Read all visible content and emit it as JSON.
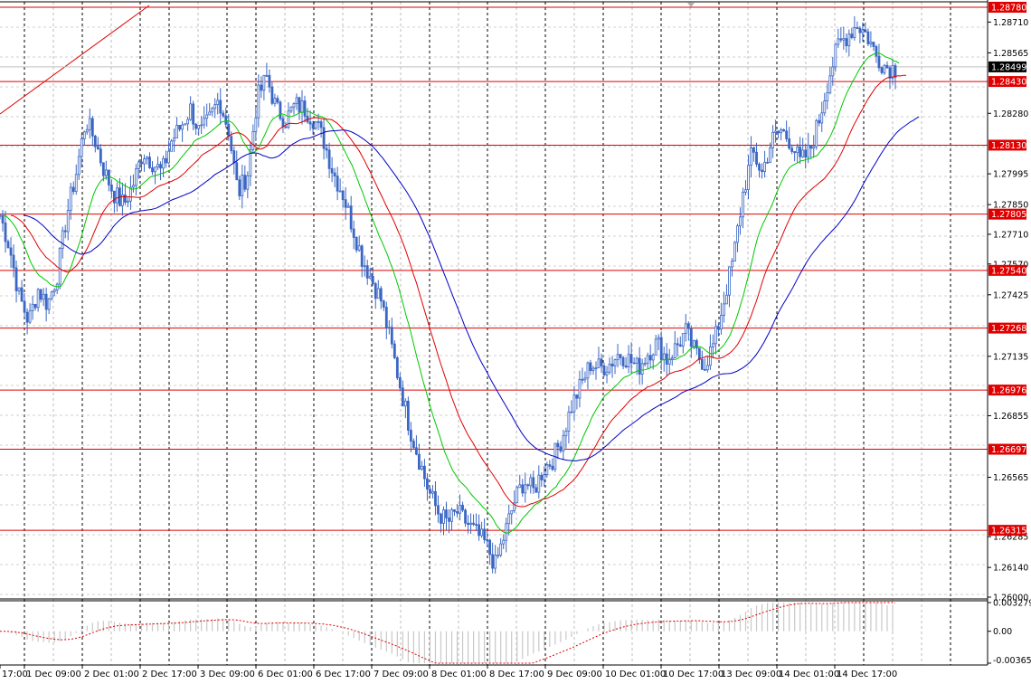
{
  "chart_data": {
    "type": "candlestick",
    "price_axis": {
      "min": 1.26,
      "max": 1.2878,
      "ticks": [
        "1.28710",
        "1.28565",
        "1.28280",
        "1.27995",
        "1.27850",
        "1.27710",
        "1.27570",
        "1.27425",
        "1.27135",
        "1.26855",
        "1.26565",
        "1.26285",
        "1.26140",
        "1.26000"
      ]
    },
    "indicator_axis": {
      "min": -0.003654,
      "max": 0.003279,
      "ticks": [
        "0.003279",
        "0.00",
        "-0.003654"
      ]
    },
    "time_labels": [
      "17:00",
      "1 Dec 09:00",
      "2 Dec 01:00",
      "2 Dec 17:00",
      "3 Dec 09:00",
      "6 Dec 01:00",
      "6 Dec 17:00",
      "7 Dec 09:00",
      "8 Dec 01:00",
      "8 Dec 17:00",
      "9 Dec 09:00",
      "10 Dec 01:00",
      "10 Dec 17:00",
      "13 Dec 09:00",
      "14 Dec 01:00",
      "14 Dec 17:00"
    ],
    "horizontal_levels": [
      {
        "value": 1.2878,
        "label": "1.28780"
      },
      {
        "value": 1.2843,
        "label": "1.28430"
      },
      {
        "value": 1.2813,
        "label": "1.28130"
      },
      {
        "value": 1.27805,
        "label": "1.27805"
      },
      {
        "value": 1.2754,
        "label": "1.27540"
      },
      {
        "value": 1.27268,
        "label": "1.27268"
      },
      {
        "value": 1.26976,
        "label": "1.26976"
      },
      {
        "value": 1.26697,
        "label": "1.26697"
      },
      {
        "value": 1.26315,
        "label": "1.26315"
      }
    ],
    "current_price": {
      "value": 1.28499,
      "label": "1.28499"
    },
    "price_path": [
      1.278,
      1.2765,
      1.2742,
      1.273,
      1.2745,
      1.2738,
      1.2752,
      1.278,
      1.28,
      1.2825,
      1.2815,
      1.28,
      1.279,
      1.2785,
      1.2795,
      1.281,
      1.2805,
      1.28,
      1.2815,
      1.2822,
      1.283,
      1.2818,
      1.2825,
      1.2835,
      1.282,
      1.279,
      1.28,
      1.2835,
      1.2845,
      1.283,
      1.2825,
      1.2832,
      1.283,
      1.2825,
      1.2815,
      1.28,
      1.279,
      1.2775,
      1.276,
      1.275,
      1.274,
      1.272,
      1.27,
      1.268,
      1.2665,
      1.265,
      1.264,
      1.2635,
      1.264,
      1.2635,
      1.263,
      1.2625,
      1.2615,
      1.263,
      1.2645,
      1.2655,
      1.265,
      1.266,
      1.2665,
      1.2675,
      1.269,
      1.27,
      1.271,
      1.2708,
      1.271,
      1.2715,
      1.2712,
      1.2708,
      1.2715,
      1.272,
      1.2712,
      1.2718,
      1.2725,
      1.2715,
      1.271,
      1.272,
      1.274,
      1.276,
      1.279,
      1.281,
      1.28,
      1.2815,
      1.282,
      1.2815,
      1.2805,
      1.281,
      1.2825,
      1.2845,
      1.286,
      1.2865,
      1.287,
      1.2865,
      1.2855,
      1.285,
      1.2849
    ],
    "moving_averages": [
      {
        "color": "#00c800",
        "period": 8
      },
      {
        "color": "#e00000",
        "period": 14
      },
      {
        "color": "#0000c8",
        "period": 26
      }
    ],
    "colors": {
      "candle": "#3a66c4",
      "level_line": "#e00000",
      "grid": "#7f7f7f",
      "trend_line": "#e00000",
      "label_bg": "#e00000",
      "current_bg": "#000000",
      "hist": "#c8c8c8",
      "signal": "#e00000"
    }
  }
}
